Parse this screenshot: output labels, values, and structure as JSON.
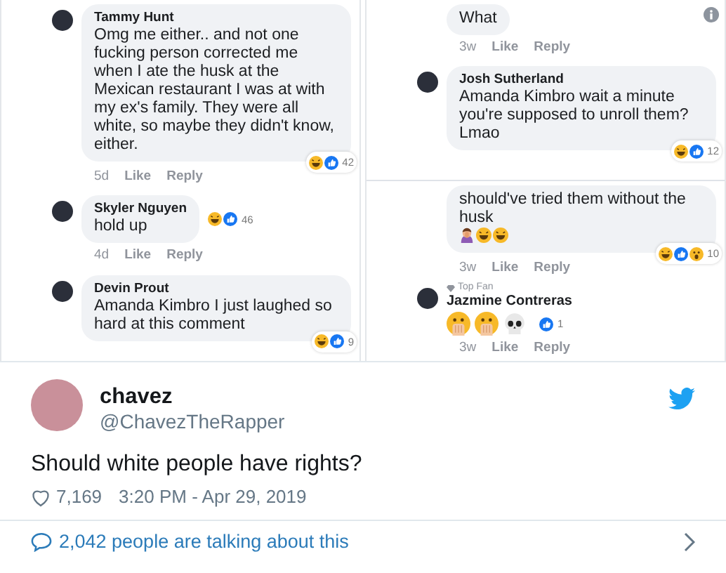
{
  "screenshots": [
    {
      "sections": [
        {
          "comments": [
            {
              "kind": "text",
              "author": "Tammy Hunt",
              "text": "Omg me either.. and not one fucking person corrected me when I ate the husk at the Mexican restaurant I was at with my ex's family. They were all white, so maybe they didn't know, either.",
              "reactions": [
                {
                  "kind": "laugh"
                },
                {
                  "kind": "like"
                }
              ],
              "reaction_count": "42",
              "meta": {
                "time": "5d",
                "like": "Like",
                "reply": "Reply"
              }
            },
            {
              "kind": "text",
              "author": "Skyler Nguyen",
              "text": "hold up",
              "reactions": [
                {
                  "kind": "laugh"
                },
                {
                  "kind": "like"
                }
              ],
              "reaction_count": "46",
              "meta": {
                "time": "4d",
                "like": "Like",
                "reply": "Reply"
              }
            },
            {
              "kind": "text",
              "author": "Devin Prout",
              "text": "Amanda Kimbro I just laughed so hard at this comment",
              "reactions": [
                {
                  "kind": "laugh"
                },
                {
                  "kind": "like"
                }
              ],
              "reaction_count": "9"
            }
          ]
        }
      ]
    },
    {
      "info_icon": true,
      "sections": [
        {
          "comments": [
            {
              "kind": "text",
              "text": "What",
              "meta": {
                "time": "3w",
                "like": "Like",
                "reply": "Reply"
              }
            },
            {
              "kind": "text",
              "author": "Josh Sutherland",
              "text": "Amanda Kimbro wait a minute you're supposed to unroll them? Lmao",
              "reactions": [
                {
                  "kind": "laugh"
                },
                {
                  "kind": "like"
                }
              ],
              "reaction_count": "12"
            }
          ]
        },
        {
          "comments": [
            {
              "kind": "text",
              "text": "should've tried them without the husk",
              "emojis": [
                {
                  "kind": "facepalm"
                },
                {
                  "kind": "laugh"
                },
                {
                  "kind": "laugh"
                }
              ],
              "reactions": [
                {
                  "kind": "laugh"
                },
                {
                  "kind": "like"
                },
                {
                  "kind": "wow"
                }
              ],
              "reaction_count": "10",
              "meta": {
                "time": "3w",
                "like": "Like",
                "reply": "Reply"
              }
            },
            {
              "kind": "emoji",
              "badge": "Top Fan",
              "author": "Jazmine Contreras",
              "emojis": [
                {
                  "kind": "cover"
                },
                {
                  "kind": "cover"
                },
                {
                  "kind": "skull"
                }
              ],
              "reactions": [
                {
                  "kind": "like"
                }
              ],
              "reaction_count": "1",
              "meta": {
                "time": "3w",
                "like": "Like",
                "reply": "Reply"
              }
            }
          ]
        }
      ]
    }
  ],
  "tweet": {
    "name": "chavez",
    "handle": "@ChavezTheRapper",
    "text": "Should white people have rights?",
    "likes": "7,169",
    "timestamp": "3:20 PM - Apr 29, 2019",
    "footer": "2,042 people are talking about this"
  }
}
